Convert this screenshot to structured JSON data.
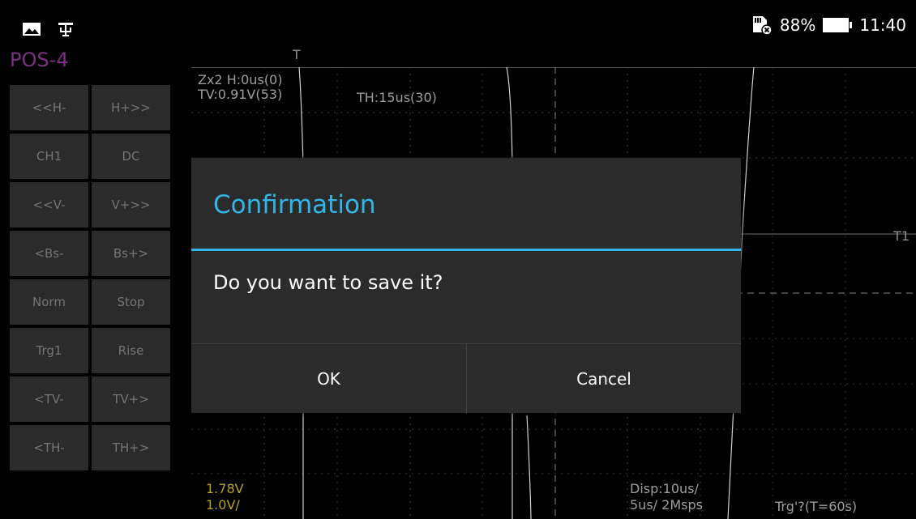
{
  "status_bar": {
    "left_icons": [
      "image-icon",
      "usb-debug-icon"
    ],
    "sim_icon": "sim-off-icon",
    "battery_percent_text": "88%",
    "battery_level": 0.88,
    "time": "11:40"
  },
  "pos_label": "POS-4",
  "buttons": [
    [
      "<<H-",
      "H+>>"
    ],
    [
      "CH1",
      "DC"
    ],
    [
      "<<V-",
      "V+>>"
    ],
    [
      "<Bs-",
      "Bs+>"
    ],
    [
      "Norm",
      "Stop"
    ],
    [
      "Trg1",
      "Rise"
    ],
    [
      "<TV-",
      "TV+>"
    ],
    [
      "<TH-",
      "TH+>"
    ]
  ],
  "scope": {
    "trigger_marker": "T",
    "zoom_info": "Zx2 H:0us(0)",
    "tv_info": "TV:0.91V(53)",
    "th_info": "TH:15us(30)",
    "t1_label": "T1",
    "voltage_top": "1.78V",
    "volt_div": "1.0V/",
    "disp": "Disp:10us/",
    "timebase": "5us/ 2Msps",
    "trigger_status": "Trg'?(T=60s)"
  },
  "dialog": {
    "title": "Confirmation",
    "message": "Do you want to save it?",
    "ok_label": "OK",
    "cancel_label": "Cancel"
  },
  "colors": {
    "accent": "#33b5e5",
    "pos_label": "#7d2f86",
    "button_bg": "#2b2b2b",
    "button_text": "#757575",
    "dialog_bg": "#2b2b2b",
    "scope_text_yellow": "#b5a31d"
  }
}
